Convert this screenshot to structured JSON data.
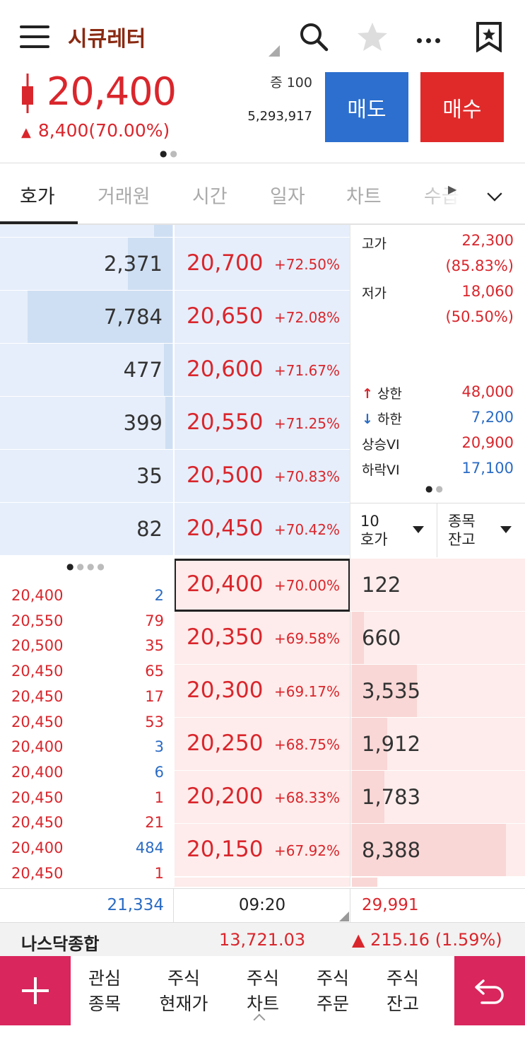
{
  "header": {
    "title": "시큐레터",
    "price": "20,400",
    "change": "8,400(70.00%)",
    "volume_label": "증 100",
    "volume": "5,293,917",
    "sell_label": "매도",
    "buy_label": "매수",
    "icons": [
      "menu-icon",
      "search-icon",
      "star-icon",
      "more-icon",
      "bookmark-star-icon"
    ]
  },
  "tabs": [
    "호가",
    "거래원",
    "시간",
    "일자",
    "차트",
    "수급"
  ],
  "asks": [
    {
      "qty": "2,371",
      "price": "20,700",
      "pct": "+72.50%",
      "level": 0.26
    },
    {
      "qty": "7,784",
      "price": "20,650",
      "pct": "+72.08%",
      "level": 0.84
    },
    {
      "qty": "477",
      "price": "20,600",
      "pct": "+71.67%",
      "level": 0.05
    },
    {
      "qty": "399",
      "price": "20,550",
      "pct": "+71.25%",
      "level": 0.04
    },
    {
      "qty": "35",
      "price": "20,500",
      "pct": "+70.83%",
      "level": 0.0
    },
    {
      "qty": "82",
      "price": "20,450",
      "pct": "+70.42%",
      "level": 0.0
    }
  ],
  "bids": [
    {
      "qty": "122",
      "price": "20,400",
      "pct": "+70.00%",
      "level": 0.0
    },
    {
      "qty": "660",
      "price": "20,350",
      "pct": "+69.58%",
      "level": 0.08
    },
    {
      "qty": "3,535",
      "price": "20,300",
      "pct": "+69.17%",
      "level": 0.42
    },
    {
      "qty": "1,912",
      "price": "20,250",
      "pct": "+68.75%",
      "level": 0.23
    },
    {
      "qty": "1,783",
      "price": "20,200",
      "pct": "+68.33%",
      "level": 0.21
    },
    {
      "qty": "8,388",
      "price": "20,150",
      "pct": "+67.92%",
      "level": 1.0
    }
  ],
  "stats": {
    "high_label": "고가",
    "high": "22,300",
    "high_pct": "(85.83%)",
    "low_label": "저가",
    "low": "18,060",
    "low_pct": "(50.50%)",
    "upper_label": "상한",
    "upper": "48,000",
    "lower_label": "하한",
    "lower": "7,200",
    "vi_up_label": "상승VI",
    "vi_up": "20,900",
    "vi_down_label": "하락VI",
    "vi_down": "17,100"
  },
  "selectors": {
    "a_line1": "10",
    "a_line2": "호가",
    "b_line1": "종목",
    "b_line2": "잔고"
  },
  "ticks": [
    {
      "price": "20,400",
      "qty": "2",
      "side": "blue"
    },
    {
      "price": "20,550",
      "qty": "79",
      "side": "red"
    },
    {
      "price": "20,500",
      "qty": "35",
      "side": "red"
    },
    {
      "price": "20,450",
      "qty": "65",
      "side": "red"
    },
    {
      "price": "20,450",
      "qty": "17",
      "side": "red"
    },
    {
      "price": "20,450",
      "qty": "53",
      "side": "red"
    },
    {
      "price": "20,400",
      "qty": "3",
      "side": "blue"
    },
    {
      "price": "20,400",
      "qty": "6",
      "side": "blue"
    },
    {
      "price": "20,450",
      "qty": "1",
      "side": "red"
    },
    {
      "price": "20,450",
      "qty": "21",
      "side": "red"
    },
    {
      "price": "20,400",
      "qty": "484",
      "side": "blue"
    },
    {
      "price": "20,450",
      "qty": "1",
      "side": "red"
    }
  ],
  "totals": {
    "ask_total": "21,334",
    "time": "09:20",
    "bid_total": "29,991"
  },
  "ticker": {
    "name": "나스닥종합",
    "value": "13,721.03",
    "change": "▲ 215.16 (1.59%)"
  },
  "bottom_nav": [
    {
      "line1": "관심",
      "line2": "종목"
    },
    {
      "line1": "주식",
      "line2": "현재가"
    },
    {
      "line1": "주식",
      "line2": "차트"
    },
    {
      "line1": "주식",
      "line2": "주문"
    },
    {
      "line1": "주식",
      "line2": "잔고"
    }
  ],
  "colors": {
    "up": "#d9262c",
    "down": "#2a6bc4",
    "ask_bg": "#e6eefb",
    "bid_bg": "#fdeceb",
    "accent": "#d9265c"
  }
}
